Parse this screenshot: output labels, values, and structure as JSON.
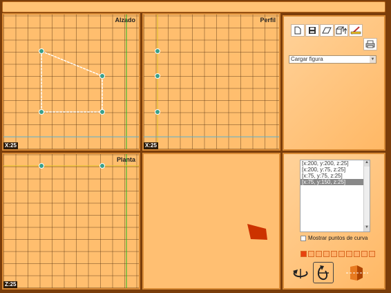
{
  "views": {
    "alzado": {
      "title": "Alzado",
      "axis_label": "X:25"
    },
    "perfil": {
      "title": "Perfil",
      "axis_label": "X:25"
    },
    "planta": {
      "title": "Planta",
      "axis_label": "Z:25"
    }
  },
  "toolbar": {
    "icons": [
      "new-file-icon",
      "save-icon",
      "eraser-icon",
      "extrude-icon",
      "clear-icon",
      "print-icon"
    ]
  },
  "loader": {
    "selected": "Cargar figura"
  },
  "points": {
    "items": [
      "[x:200, y:200, z:25]",
      "[x:200, y:75, z:25]",
      "[x:75, y:75, z:25]",
      "[x:75, y:150, z:25]"
    ],
    "selected_index": 3
  },
  "curve_option": {
    "label": "Mostrar puntos de curva",
    "checked": false
  },
  "colors": {
    "frame": "#7a3d0a",
    "panel": "#ffbe6e",
    "accent": "#e84310",
    "shape": "#cc3300"
  },
  "swatch_count": 10
}
